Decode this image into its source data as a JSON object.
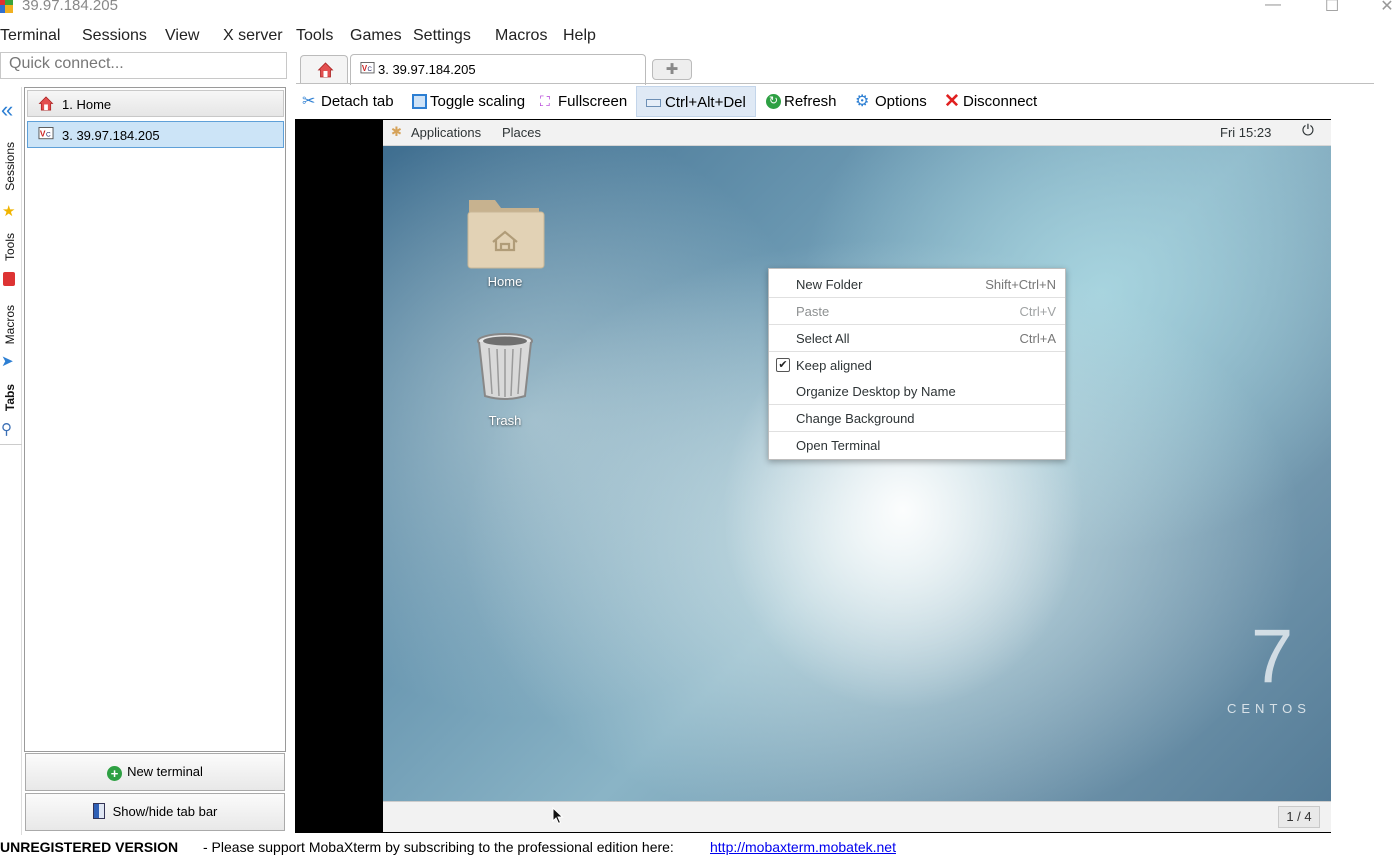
{
  "window": {
    "title": "39.97.184.205",
    "minimize": "—",
    "maximize": "☐",
    "close": "✕"
  },
  "menubar": {
    "items": [
      "Terminal",
      "Sessions",
      "View",
      "X server",
      "Tools",
      "Games",
      "Settings",
      "Macros",
      "Help"
    ]
  },
  "quick_connect": {
    "placeholder": "Quick connect..."
  },
  "tabs": {
    "active_label": "3. 39.97.184.205",
    "add_label": "✚"
  },
  "side_rail": {
    "items": [
      "Sessions",
      "Tools",
      "Macros",
      "Tabs"
    ]
  },
  "sessions": {
    "items": [
      {
        "label": "1. Home",
        "icon": "home-icon"
      },
      {
        "label": "3. 39.97.184.205",
        "icon": "vnc-icon"
      }
    ],
    "new_terminal": "New terminal",
    "show_hide_tab_bar": "Show/hide tab bar"
  },
  "toolbar": {
    "detach": "Detach tab",
    "toggle_scaling": "Toggle scaling",
    "fullscreen": "Fullscreen",
    "ctrl_alt_del": "Ctrl+Alt+Del",
    "refresh": "Refresh",
    "options": "Options",
    "disconnect": "Disconnect"
  },
  "gnome": {
    "applications": "Applications",
    "places": "Places",
    "clock": "Fri 15:23",
    "workspace": "1 / 4"
  },
  "desktop_icons": {
    "home": "Home",
    "trash": "Trash"
  },
  "context_menu": {
    "new_folder": {
      "label": "New Folder",
      "shortcut": "Shift+Ctrl+N"
    },
    "paste": {
      "label": "Paste",
      "shortcut": "Ctrl+V"
    },
    "select_all": {
      "label": "Select All",
      "shortcut": "Ctrl+A"
    },
    "keep_aligned": {
      "label": "Keep aligned",
      "checked": true
    },
    "organize": {
      "label": "Organize Desktop by Name"
    },
    "change_background": {
      "label": "Change Background"
    },
    "open_terminal": {
      "label": "Open Terminal"
    }
  },
  "wallpaper": {
    "number": "7",
    "brand": "CENTOS"
  },
  "statusbar": {
    "unregistered": "UNREGISTERED VERSION",
    "message": "-  Please support MobaXterm by subscribing to the professional edition here:",
    "link": "http://mobaxterm.mobatek.net"
  },
  "colors": {
    "accent": "#0067c0",
    "selection": "#cce4f7",
    "remote_bg": "#000000"
  }
}
